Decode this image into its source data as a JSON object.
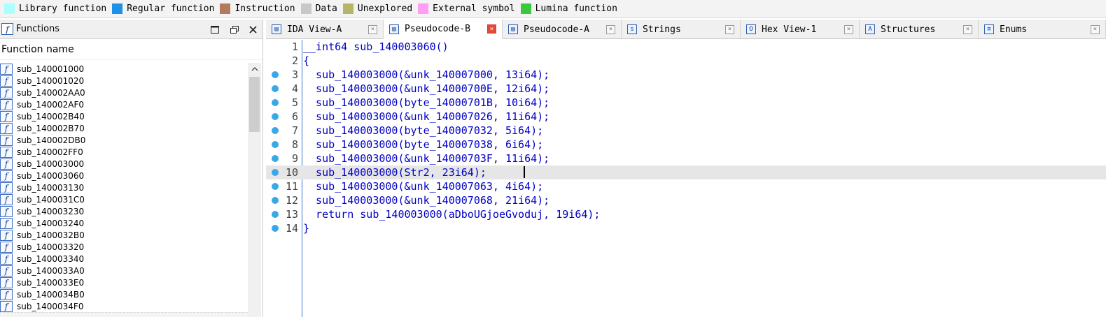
{
  "legend": [
    {
      "label": "Library function",
      "color": "#aaffff"
    },
    {
      "label": "Regular function",
      "color": "#1e90e6"
    },
    {
      "label": "Instruction",
      "color": "#b47a5e"
    },
    {
      "label": "Data",
      "color": "#c8c8c8"
    },
    {
      "label": "Unexplored",
      "color": "#b5b56a"
    },
    {
      "label": "External symbol",
      "color": "#ff9cf5"
    },
    {
      "label": "Lumina function",
      "color": "#3cc83c"
    }
  ],
  "functions_panel": {
    "title": "Functions",
    "column_header": "Function name",
    "items": [
      "sub_140001000",
      "sub_140001020",
      "sub_140002AA0",
      "sub_140002AF0",
      "sub_140002B40",
      "sub_140002B70",
      "sub_140002DB0",
      "sub_140002FF0",
      "sub_140003000",
      "sub_140003060",
      "sub_140003130",
      "sub_1400031C0",
      "sub_140003230",
      "sub_140003240",
      "sub_1400032B0",
      "sub_140003320",
      "sub_140003340",
      "sub_1400033A0",
      "sub_1400033E0",
      "sub_1400034B0",
      "sub_1400034F0"
    ]
  },
  "tabs": [
    {
      "label": "IDA View-A",
      "icon": "ida-view-icon",
      "glyph": "▤",
      "active": false
    },
    {
      "label": "Pseudocode-B",
      "icon": "pseudocode-icon",
      "glyph": "▤",
      "active": true
    },
    {
      "label": "Pseudocode-A",
      "icon": "pseudocode-icon",
      "glyph": "▤",
      "active": false
    },
    {
      "label": "Strings",
      "icon": "strings-icon",
      "glyph": "s",
      "active": false
    },
    {
      "label": "Hex View-1",
      "icon": "hex-view-icon",
      "glyph": "O",
      "active": false
    },
    {
      "label": "Structures",
      "icon": "structures-icon",
      "glyph": "A",
      "active": false
    },
    {
      "label": "Enums",
      "icon": "enums-icon",
      "glyph": "≡",
      "active": false
    }
  ],
  "code": {
    "lines": [
      {
        "n": "1",
        "text": "__int64 sub_140003060()",
        "dot": false
      },
      {
        "n": "2",
        "text": "{",
        "dot": false
      },
      {
        "n": "3",
        "text": "  sub_140003000(&unk_140007000, 13i64);",
        "dot": true
      },
      {
        "n": "4",
        "text": "  sub_140003000(&unk_14000700E, 12i64);",
        "dot": true
      },
      {
        "n": "5",
        "text": "  sub_140003000(byte_14000701B, 10i64);",
        "dot": true
      },
      {
        "n": "6",
        "text": "  sub_140003000(&unk_140007026, 11i64);",
        "dot": true
      },
      {
        "n": "7",
        "text": "  sub_140003000(byte_140007032, 5i64);",
        "dot": true
      },
      {
        "n": "8",
        "text": "  sub_140003000(byte_140007038, 6i64);",
        "dot": true
      },
      {
        "n": "9",
        "text": "  sub_140003000(&unk_14000703F, 11i64);",
        "dot": true
      },
      {
        "n": "10",
        "text": "  sub_140003000(Str2, 23i64);",
        "dot": true,
        "current": true
      },
      {
        "n": "11",
        "text": "  sub_140003000(&unk_140007063, 4i64);",
        "dot": true
      },
      {
        "n": "12",
        "text": "  sub_140003000(&unk_140007068, 21i64);",
        "dot": true
      },
      {
        "n": "13",
        "text": "  return sub_140003000(aDboUGjoeGvoduj, 19i64);",
        "dot": true
      },
      {
        "n": "14",
        "text": "}",
        "dot": true
      }
    ]
  }
}
